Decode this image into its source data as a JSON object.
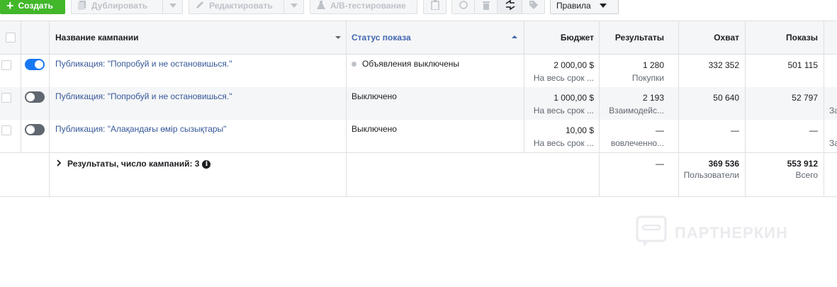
{
  "toolbar": {
    "create_label": "Создать",
    "duplicate_label": "Дублировать",
    "edit_label": "Редактировать",
    "ab_label": "A/B-тестирование",
    "rules_label": "Правила"
  },
  "table": {
    "columns": {
      "name": "Название кампании",
      "status": "Статус показа",
      "budget": "Бюджет",
      "results": "Результаты",
      "reach": "Охват",
      "impressions": "Показы"
    },
    "rows": [
      {
        "toggle_on": true,
        "name": "Публикация: \"Попробуй и не остановишься.\"",
        "status": "Объявления выключены",
        "budget": "2 000,00 $",
        "budget_sub": "На весь срок ...",
        "results": "1 280",
        "results_sub": "Покупки",
        "reach": "332 352",
        "impressions": "501 115",
        "extra": ""
      },
      {
        "toggle_on": false,
        "name": "Публикация: \"Попробуй и не остановишься.\"",
        "status": "Выключено",
        "budget": "1 000,00 $",
        "budget_sub": "На весь срок ...",
        "results": "2 193",
        "results_sub": "Взаимодейс...",
        "reach": "50 640",
        "impressions": "52 797",
        "extra": "За"
      },
      {
        "toggle_on": false,
        "name": "Публикация: \"Алақандағы өмір сызықтары\"",
        "status": "Выключено",
        "budget": "10,00 $",
        "budget_sub": "На весь срок ...",
        "results": "—",
        "results_sub": "вовлеченно...",
        "reach": "—",
        "impressions": "—",
        "extra": "За"
      }
    ],
    "summary": {
      "label": "Результаты, число кампаний: 3",
      "results": "—",
      "reach": "369 536",
      "reach_sub": "Пользователи",
      "impressions": "553 912",
      "impressions_sub": "Всего"
    }
  },
  "watermark": {
    "text": "ПАРТНЕРКИН"
  },
  "colors": {
    "create_green": "#42b72a",
    "link_blue": "#365899",
    "toggle_on": "#1877f2",
    "toggle_off": "#606770"
  }
}
